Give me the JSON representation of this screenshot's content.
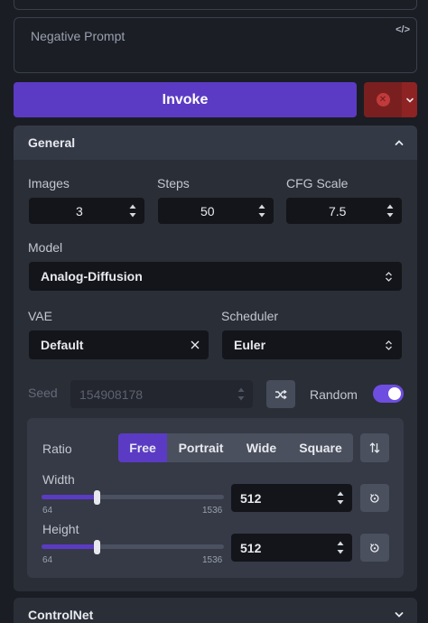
{
  "prompt": {
    "negative_placeholder": "Negative Prompt"
  },
  "actions": {
    "invoke_label": "Invoke"
  },
  "general": {
    "title": "General",
    "images": {
      "label": "Images",
      "value": "3"
    },
    "steps": {
      "label": "Steps",
      "value": "50"
    },
    "cfg_scale": {
      "label": "CFG Scale",
      "value": "7.5"
    },
    "model": {
      "label": "Model",
      "value": "Analog-Diffusion"
    },
    "vae": {
      "label": "VAE",
      "value": "Default"
    },
    "scheduler": {
      "label": "Scheduler",
      "value": "Euler"
    },
    "seed": {
      "label": "Seed",
      "value": "154908178",
      "random_label": "Random",
      "random_enabled": true
    },
    "ratio": {
      "label": "Ratio",
      "options": [
        "Free",
        "Portrait",
        "Wide",
        "Square"
      ],
      "selected": "Free"
    },
    "width": {
      "label": "Width",
      "value": "512",
      "min": "64",
      "max": "1536"
    },
    "height": {
      "label": "Height",
      "value": "512",
      "min": "64",
      "max": "1536"
    }
  },
  "controlnet": {
    "title": "ControlNet"
  },
  "icons": {
    "code": "code-icon",
    "cancel": "x-circle-icon",
    "chevron_down": "chevron-down-icon",
    "chevron_up": "chevron-up-icon",
    "shuffle": "shuffle-icon",
    "swap": "swap-vertical-icon",
    "reset": "reset-icon",
    "clear": "close-icon",
    "select": "select-arrows-icon"
  },
  "colors": {
    "accent": "#5b3bc4",
    "cancel": "#7a1f1f",
    "panel": "#2a2e37",
    "background": "#1a1d24"
  }
}
